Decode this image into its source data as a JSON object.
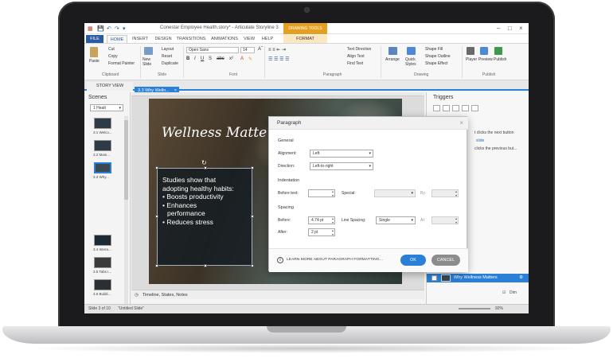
{
  "window": {
    "title": "Conestar Employee Health.story* - Articulate Storyline 3",
    "context_tab_group": "DRAWING TOOLS"
  },
  "tabs": [
    "FILE",
    "HOME",
    "INSERT",
    "DESIGN",
    "TRANSITIONS",
    "ANIMATIONS",
    "VIEW",
    "HELP",
    "FORMAT"
  ],
  "ribbon": {
    "clipboard": {
      "paste": "Paste",
      "cut": "Cut",
      "copy": "Copy",
      "format_painter": "Format Painter",
      "label": "Clipboard"
    },
    "slide": {
      "new_slide": "New Slide",
      "layout": "Layout",
      "reset": "Reset",
      "duplicate": "Duplicate",
      "label": "Slide"
    },
    "font": {
      "font_name": "Open Sans",
      "font_size": "14",
      "label": "Font"
    },
    "paragraph": {
      "text_direction": "Text Direction",
      "align_text": "Align Text",
      "find_text": "Find Text",
      "label": "Paragraph"
    },
    "drawing": {
      "arrange": "Arrange",
      "quick_styles": "Quick Styles",
      "shape_fill": "Shape Fill",
      "shape_outline": "Shape Outline",
      "shape_effect": "Shape Effect",
      "label": "Drawing"
    },
    "publish": {
      "player": "Player",
      "preview": "Preview",
      "publish": "Publish",
      "label": "Publish"
    }
  },
  "doc_tabs": {
    "story_view": "STORY VIEW",
    "slide_tab": "3.3 Why Welln..."
  },
  "scenes": {
    "title": "Scenes",
    "selected_scene": "1 Healt",
    "slides": [
      "3.1 Welco...",
      "3.2 Main...",
      "3.3 Why...",
      "3.4 Intera...",
      "3.5 Tabs I...",
      "3.6 Buildi..."
    ]
  },
  "slide": {
    "title": "Wellness Matte",
    "textbox_lines": [
      "Studies show that",
      "adopting healthy habits:",
      "• Boosts productivity",
      "• Enhances",
      "  performance",
      "• Reduces stress"
    ]
  },
  "timeline_bar": "Timeline, States, Notes",
  "status_bar": {
    "slide_info": "Slide 3 of 10",
    "layout_name": "\"Untitled Slide\"",
    "zoom": "92%"
  },
  "triggers": {
    "title": "Triggers",
    "line1": "t clicks the next button",
    "line2": "slide",
    "line3": "clicks the previous but...",
    "layer_name": "Why Wellness Matters",
    "dim_label": "Dim"
  },
  "dialog": {
    "title": "Paragraph",
    "general": {
      "section": "General",
      "alignment_label": "Alignment:",
      "alignment_value": "Left",
      "direction_label": "Direction:",
      "direction_value": "Left-to-right"
    },
    "indentation": {
      "section": "Indentation",
      "before_text_label": "Before text:",
      "special_label": "Special:",
      "by_label": "By:"
    },
    "spacing": {
      "section": "Spacing",
      "before_label": "Before:",
      "before_value": "4.74 pt",
      "after_label": "After:",
      "after_value": "2 pt",
      "line_spacing_label": "Line Spacing:",
      "line_spacing_value": "Single",
      "at_label": "At:"
    },
    "learn_more": "LEARN MORE ABOUT PARAGRAPH FORMATTING...",
    "ok": "OK",
    "cancel": "CANCEL"
  }
}
